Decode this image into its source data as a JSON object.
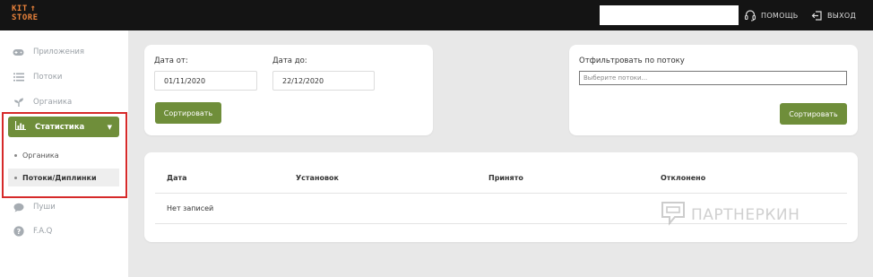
{
  "header": {
    "logo_line1": "KIT",
    "logo_arrow": "↑",
    "logo_line2": "STORE",
    "help_label": "ПОМОЩЬ",
    "logout_label": "ВЫХОД",
    "help_icon": "headset-icon",
    "logout_icon": "logout-icon"
  },
  "sidebar": {
    "items": [
      {
        "label": "Приложения",
        "icon": "gamepad-icon"
      },
      {
        "label": "Потоки",
        "icon": "list-icon"
      },
      {
        "label": "Органика",
        "icon": "sprout-icon"
      },
      {
        "label": "Статистика",
        "icon": "bar-chart-icon",
        "active": true
      },
      {
        "label": "Пуши",
        "icon": "chat-bubble-icon"
      },
      {
        "label": "F.A.Q",
        "icon": "question-icon"
      }
    ],
    "sub_items": [
      {
        "label": "Органика"
      },
      {
        "label": "Потоки/Диплинки",
        "selected": true
      }
    ]
  },
  "dates_card": {
    "from_label": "Дата от:",
    "from_value": "01/11/2020",
    "to_label": "Дата до:",
    "to_value": "22/12/2020",
    "sort_button": "Сортировать"
  },
  "filter_card": {
    "title": "Отфильтровать по потоку",
    "placeholder": "Выберите потоки...",
    "sort_button": "Сортировать"
  },
  "table": {
    "columns": [
      "Дата",
      "Установок",
      "Принято",
      "Отклонено"
    ],
    "empty_text": "Нет записей"
  },
  "watermark": {
    "text": "ПАРТНЕРКИН"
  },
  "colors": {
    "accent_green": "#6f8e3a",
    "logo_orange": "#e9823b",
    "highlight_red": "#d62a2a",
    "topbar": "#141414"
  }
}
